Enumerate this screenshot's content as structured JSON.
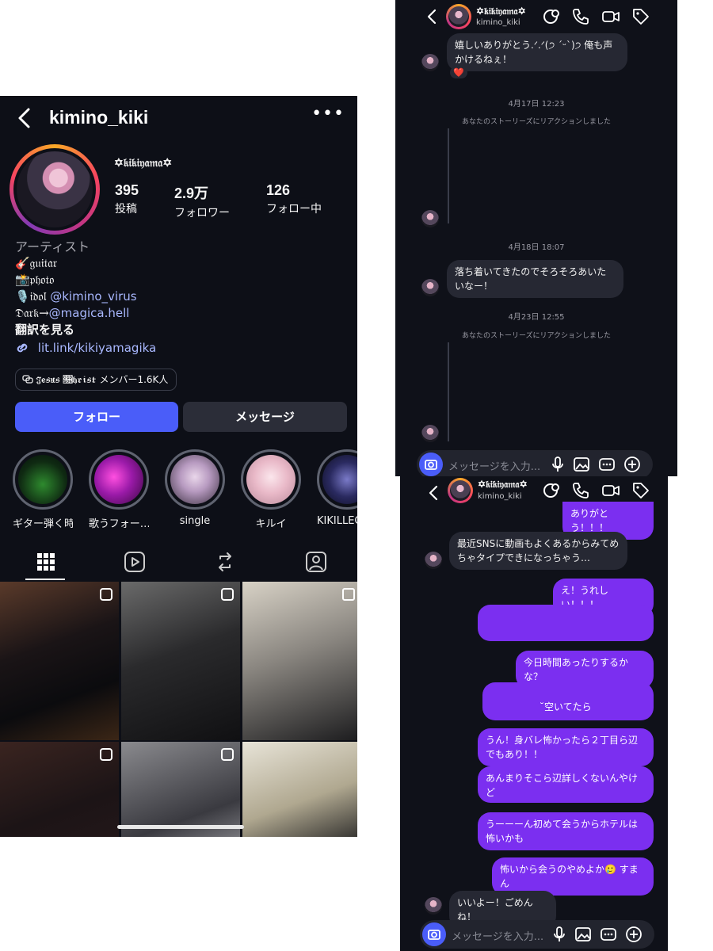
{
  "colors": {
    "accent": "#4a5df9",
    "outgoing_bubble": "#7b2ff0",
    "incoming_bubble": "#262833",
    "background": "#0d0f17",
    "link": "#a9b8ff"
  },
  "profile": {
    "username": "kimino_kiki",
    "more": "•••",
    "display_name": "✡𝔨𝔦𝔨𝔦𝔶𝔞𝔪𝔞✡",
    "stats": [
      {
        "value": "395",
        "label": "投稿"
      },
      {
        "value": "2.9万",
        "label": "フォロワー"
      },
      {
        "value": "126",
        "label": "フォロー中"
      }
    ],
    "category": "アーティスト",
    "bio": {
      "guitar": "🎸𝔤𝔲𝔦𝔱𝔞𝔯",
      "photo": "📸𝔭𝔥𝔬𝔱𝔬",
      "idol_prefix": "🎙️𝔦𝔡𝔬𝔩 ",
      "idol_mention": "@kimino_virus",
      "dark_prefix": "𝔇𝔞𝔯𝔨→",
      "dark_mention": "@magica.hell",
      "translate": "翻訳を見る",
      "link": "lit.link/kikiyamagika"
    },
    "community": "𝔍𝔢𝔰𝔲𝔰 𝔆𝔥𝔯𝔦𝔰𝔱 メンバー1.6K人",
    "follow_button": "フォロー",
    "message_button": "メッセージ",
    "highlights": [
      {
        "label": "ギター弾く時"
      },
      {
        "label": "歌うフォー…"
      },
      {
        "label": "single"
      },
      {
        "label": "キルイ"
      },
      {
        "label": "KIKILLEG"
      }
    ],
    "tab_icons": [
      "grid-icon",
      "reels-icon",
      "repost-icon",
      "tagged-icon"
    ]
  },
  "chat_top": {
    "display_name": "✡𝔨𝔦𝔨𝔦𝔶𝔞𝔪𝔞✡",
    "username": "kimino_kiki",
    "messages": {
      "m1": "嬉しいありがとう.ᐟ.ᐟ(੭ ˊᵕˋ)੭ 俺も声かけるねぇ！",
      "reaction": "❤️",
      "ts1": "4月17日 12:23",
      "sys1": "あなたのストーリーズにリアクションしました",
      "ts2": "4月18日 18:07",
      "m2": "落ち着いてきたのでそろそろあいたいなー！",
      "ts3": "4月23日 12:55",
      "sys2": "あなたのストーリーズにリアクションしました"
    },
    "composer_placeholder": "メッセージを入力..."
  },
  "chat_bottom": {
    "display_name": "✡𝔨𝔦𝔨𝔦𝔶𝔞𝔪𝔞✡",
    "username": "kimino_kiki",
    "messages": {
      "o1": "ありがとう！！！",
      "i1": "最近SNSに動画もよくあるからみてめちゃタイプできになっちゃう…",
      "o2": "え！うれしい！！！",
      "o3": "今日時間あったりするかな？",
      "o4": "˘空いてたら",
      "o5": "うん！身バレ怖かったら２丁目ら辺でもあり！！",
      "o6": "あんまりそこら辺詳しくないんやけど",
      "o7": "うーーーん初めて会うからホテルは怖いかも",
      "o8": "怖いから会うのやめよか🥲 すまん",
      "i2": "いいよー！ごめんね！"
    },
    "composer_placeholder": "メッセージを入力..."
  }
}
